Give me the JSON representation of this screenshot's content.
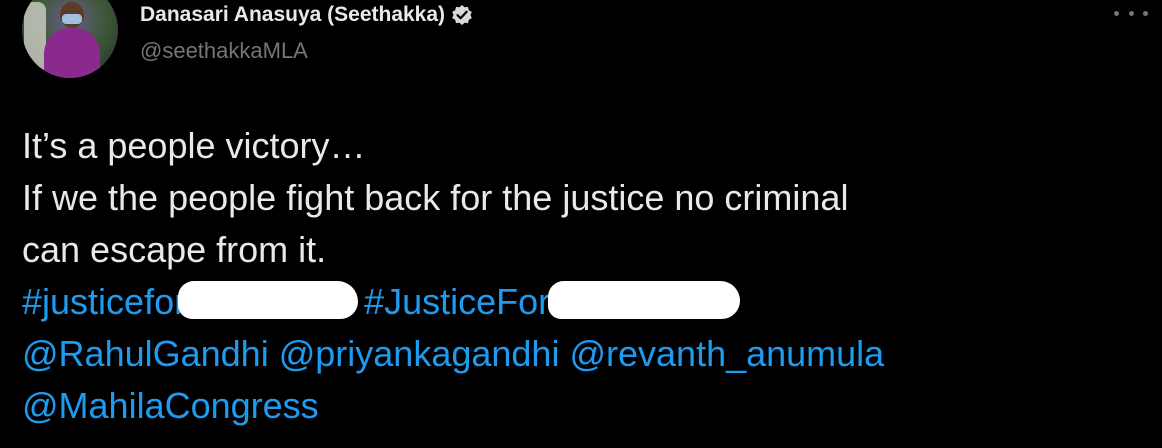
{
  "author": {
    "display_name": "Danasari Anasuya (Seethakka)",
    "handle": "@seethakkaMLA",
    "verified": true
  },
  "tweet": {
    "line1": "It’s a people victory…",
    "line2": "If we the people fight back for the justice no criminal",
    "line3": "can escape from it.",
    "hashtag1_prefix": "#justicefor",
    "hashtag2_prefix": "#JusticeFor",
    "mentions": [
      "@RahulGandhi",
      "@priyankagandhi",
      "@revanth_anumula",
      "@MahilaCongress"
    ]
  },
  "icons": {
    "verified": "verified-badge-icon",
    "more": "more-options-icon"
  },
  "colors": {
    "background": "#000000",
    "text": "#e7e9ea",
    "secondary_text": "#71767b",
    "link": "#1d9bf0",
    "redaction": "#ffffff"
  }
}
